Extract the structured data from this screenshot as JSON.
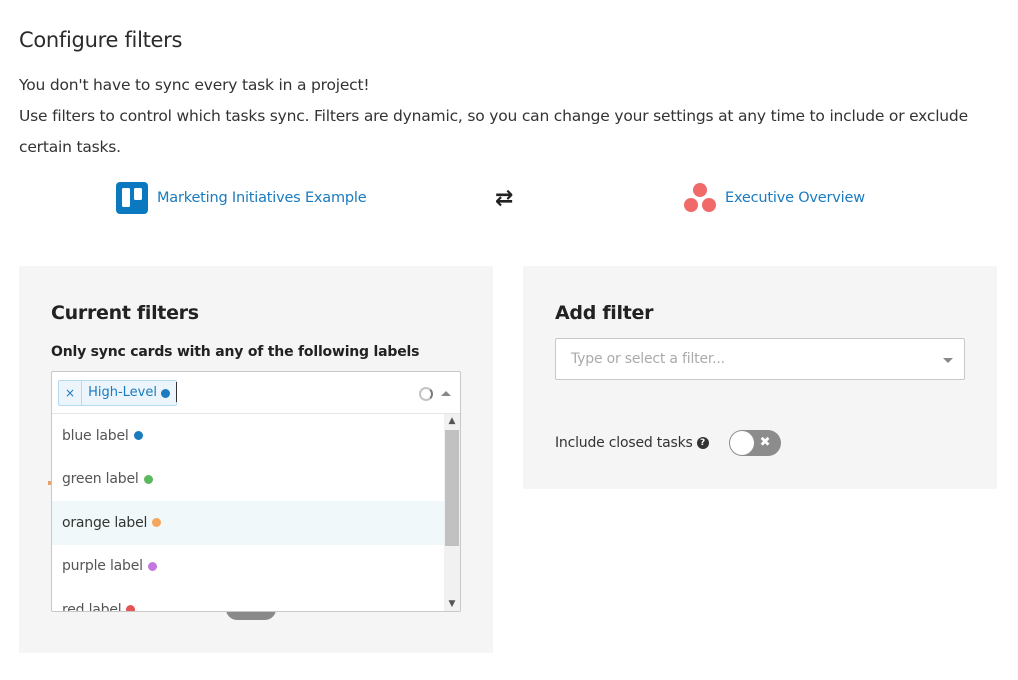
{
  "page": {
    "title": "Configure filters",
    "intro_line1": "You don't have to sync every task in a project!",
    "intro_line2": "Use filters to control which tasks sync. Filters are dynamic, so you can change your settings at any time to include or exclude certain tasks."
  },
  "projects": {
    "left": {
      "name": "Marketing Initiatives Example",
      "icon": "trello-icon",
      "color": "#0a79bf"
    },
    "swap_icon": "⇄",
    "right": {
      "name": "Executive Overview",
      "icon": "asana-icon",
      "color": "#f06a6a"
    }
  },
  "current_filters": {
    "title": "Current filters",
    "subtitle": "Only sync cards with any of the following labels",
    "selected_tag": {
      "remove_symbol": "×",
      "label": "High-Level",
      "color": "#1a7bbf"
    },
    "options": [
      {
        "label": "blue label",
        "color": "#1a7bbf"
      },
      {
        "label": "green label",
        "color": "#5cb85c"
      },
      {
        "label": "orange label",
        "color": "#f5a55c"
      },
      {
        "label": "purple label",
        "color": "#c377e0"
      },
      {
        "label": "red label",
        "color": "#e55353"
      }
    ],
    "scroll_up": "▲",
    "scroll_down": "▼"
  },
  "add_filter": {
    "title": "Add filter",
    "placeholder": "Type or select a filter...",
    "include_closed_label": "Include closed tasks",
    "help_symbol": "?",
    "toggle_off_symbol": "✖"
  }
}
